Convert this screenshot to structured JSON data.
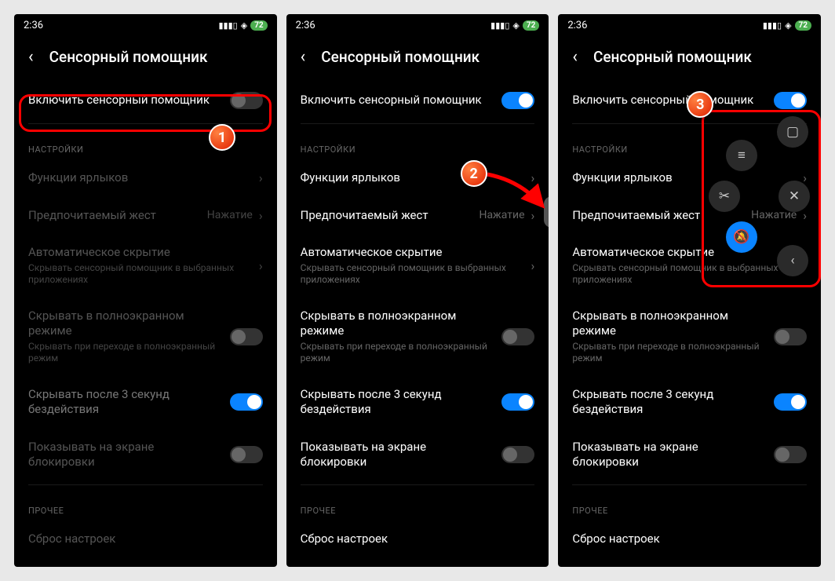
{
  "status": {
    "time": "2:36",
    "battery": "72"
  },
  "header": {
    "title": "Сенсорный помощник"
  },
  "rows": {
    "enable": "Включить сенсорный помощник",
    "section_settings": "Настройки",
    "shortcuts": "Функции ярлыков",
    "gesture": "Предпочитаемый жест",
    "gesture_value": "Нажатие",
    "autohide": "Автоматическое скрытие",
    "autohide_sub": "Скрывать сенсорный помощник в выбранных приложениях",
    "fullscreen": "Скрывать в полноэкранном режиме",
    "fullscreen_sub": "Скрывать при переходе в полноэкранный режим",
    "idle": "Скрывать после 3 секунд бездействия",
    "lockscreen": "Показывать на экране блокировки",
    "section_other": "Прочее",
    "reset": "Сброс настроек"
  },
  "badges": {
    "b1": "1",
    "b2": "2",
    "b3": "3"
  }
}
